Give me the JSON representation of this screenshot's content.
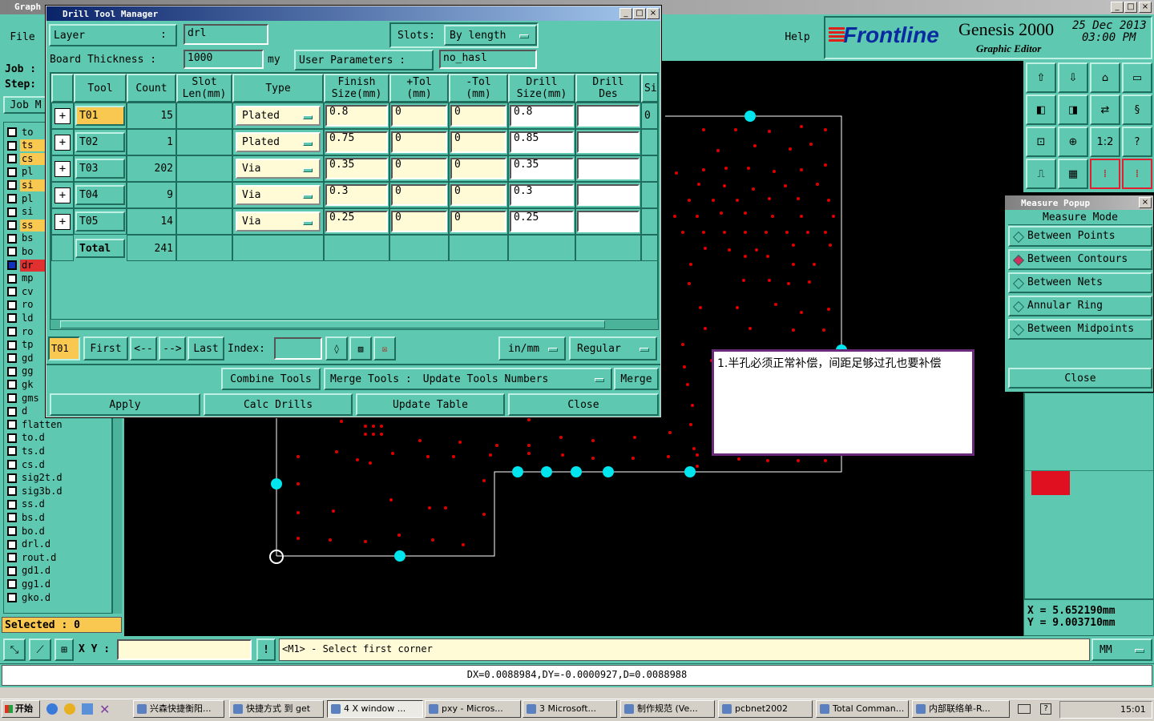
{
  "app": {
    "title": "Graph",
    "menu_file": "File",
    "menu_help": "Help",
    "logo_text": "Frontline",
    "product": "Genesis 2000",
    "subtitle": "Graphic Editor",
    "date": "25 Dec 2013",
    "time": "03:00 PM",
    "job_label": "Job :",
    "step_label": "Step:",
    "job_button": "Job M",
    "selected": "Selected : 0"
  },
  "layers": [
    "to",
    "ts",
    "cs",
    "pl",
    "si",
    "pl",
    "si",
    "ss",
    "bs",
    "bo",
    "dr",
    "mp",
    "cv",
    "ro",
    "ld",
    "ro",
    "tp",
    "gd",
    "gg",
    "gk",
    "gms",
    "d",
    "flatten",
    "to.d",
    "ts.d",
    "cs.d",
    "sig2t.d",
    "sig3b.d",
    "ss.d",
    "bs.d",
    "bo.d",
    "drl.d",
    "rout.d",
    "gd1.d",
    "gg1.d",
    "gko.d"
  ],
  "dialog": {
    "title": "Drill Tool Manager",
    "layer_label": "Layer",
    "layer_colon": ":",
    "layer_value": "drl",
    "slots_label": "Slots:",
    "slots_value": "By length",
    "thickness_label": "Board Thickness :",
    "thickness_value": "1000",
    "thickness_unit": "my",
    "user_params_label": "User Parameters :",
    "user_params_value": "no_hasl",
    "headers": {
      "tool": "Tool",
      "count": "Count",
      "slot1": "Slot",
      "slot2": "Len(mm)",
      "type": "Type",
      "finish1": "Finish",
      "finish2": "Size(mm)",
      "ptol1": "+Tol",
      "ptol2": "(mm)",
      "mtol1": "-Tol",
      "mtol2": "(mm)",
      "drill1": "Drill",
      "drill2": "Size(mm)",
      "des1": "Drill",
      "des2": "Des",
      "si": "Si"
    },
    "rows": [
      {
        "tool": "T01",
        "count": "15",
        "type": "Plated",
        "finish": "0.8",
        "ptol": "0",
        "mtol": "0",
        "drill": "0.8",
        "extra": "0"
      },
      {
        "tool": "T02",
        "count": "1",
        "type": "Plated",
        "finish": "0.75",
        "ptol": "0",
        "mtol": "0",
        "drill": "0.85",
        "extra": ""
      },
      {
        "tool": "T03",
        "count": "202",
        "type": "Via",
        "finish": "0.35",
        "ptol": "0",
        "mtol": "0",
        "drill": "0.35",
        "extra": ""
      },
      {
        "tool": "T04",
        "count": "9",
        "type": "Via",
        "finish": "0.3",
        "ptol": "0",
        "mtol": "0",
        "drill": "0.3",
        "extra": ""
      },
      {
        "tool": "T05",
        "count": "14",
        "type": "Via",
        "finish": "0.25",
        "ptol": "0",
        "mtol": "0",
        "drill": "0.25",
        "extra": ""
      }
    ],
    "total_label": "Total",
    "total_value": "241",
    "current_tool": "T01",
    "nav": {
      "first": "First",
      "prev": "<--",
      "next": "-->",
      "last": "Last",
      "index": "Index:"
    },
    "units": "in/mm",
    "mode": "Regular",
    "combine": "Combine Tools",
    "merge_tools": "Merge Tools :",
    "update_numbers": "Update Tools Numbers",
    "merge": "Merge",
    "apply": "Apply",
    "calc": "Calc Drills",
    "update_table": "Update Table",
    "close": "Close"
  },
  "measure": {
    "title": "Measure Popup",
    "mode_label": "Measure Mode",
    "options": [
      "Between Points",
      "Between Contours",
      "Between Nets",
      "Annular Ring",
      "Between Midpoints"
    ],
    "selected_index": 1,
    "close": "Close"
  },
  "note_text": "1.半孔必须正常补偿，间距足够过孔也要补偿",
  "coords": {
    "x": "X  =  5.652190mm",
    "y": "Y  =  9.003710mm"
  },
  "status": {
    "xy_label": "X Y :",
    "prompt": "<M1> - Select first corner",
    "units": "MM",
    "delta": "DX=0.0088984,DY=-0.0000927,D=0.0088988"
  },
  "taskbar": {
    "start": "开始",
    "clock": "15:01",
    "items": [
      "兴森快捷衡阳...",
      "快捷方式 到 get",
      "4 X window ...",
      "pxy - Micros...",
      "3 Microsoft...",
      "制作规范 (Ve...",
      "pcbnet2002",
      "Total Comman...",
      "内部联络单-R..."
    ]
  }
}
